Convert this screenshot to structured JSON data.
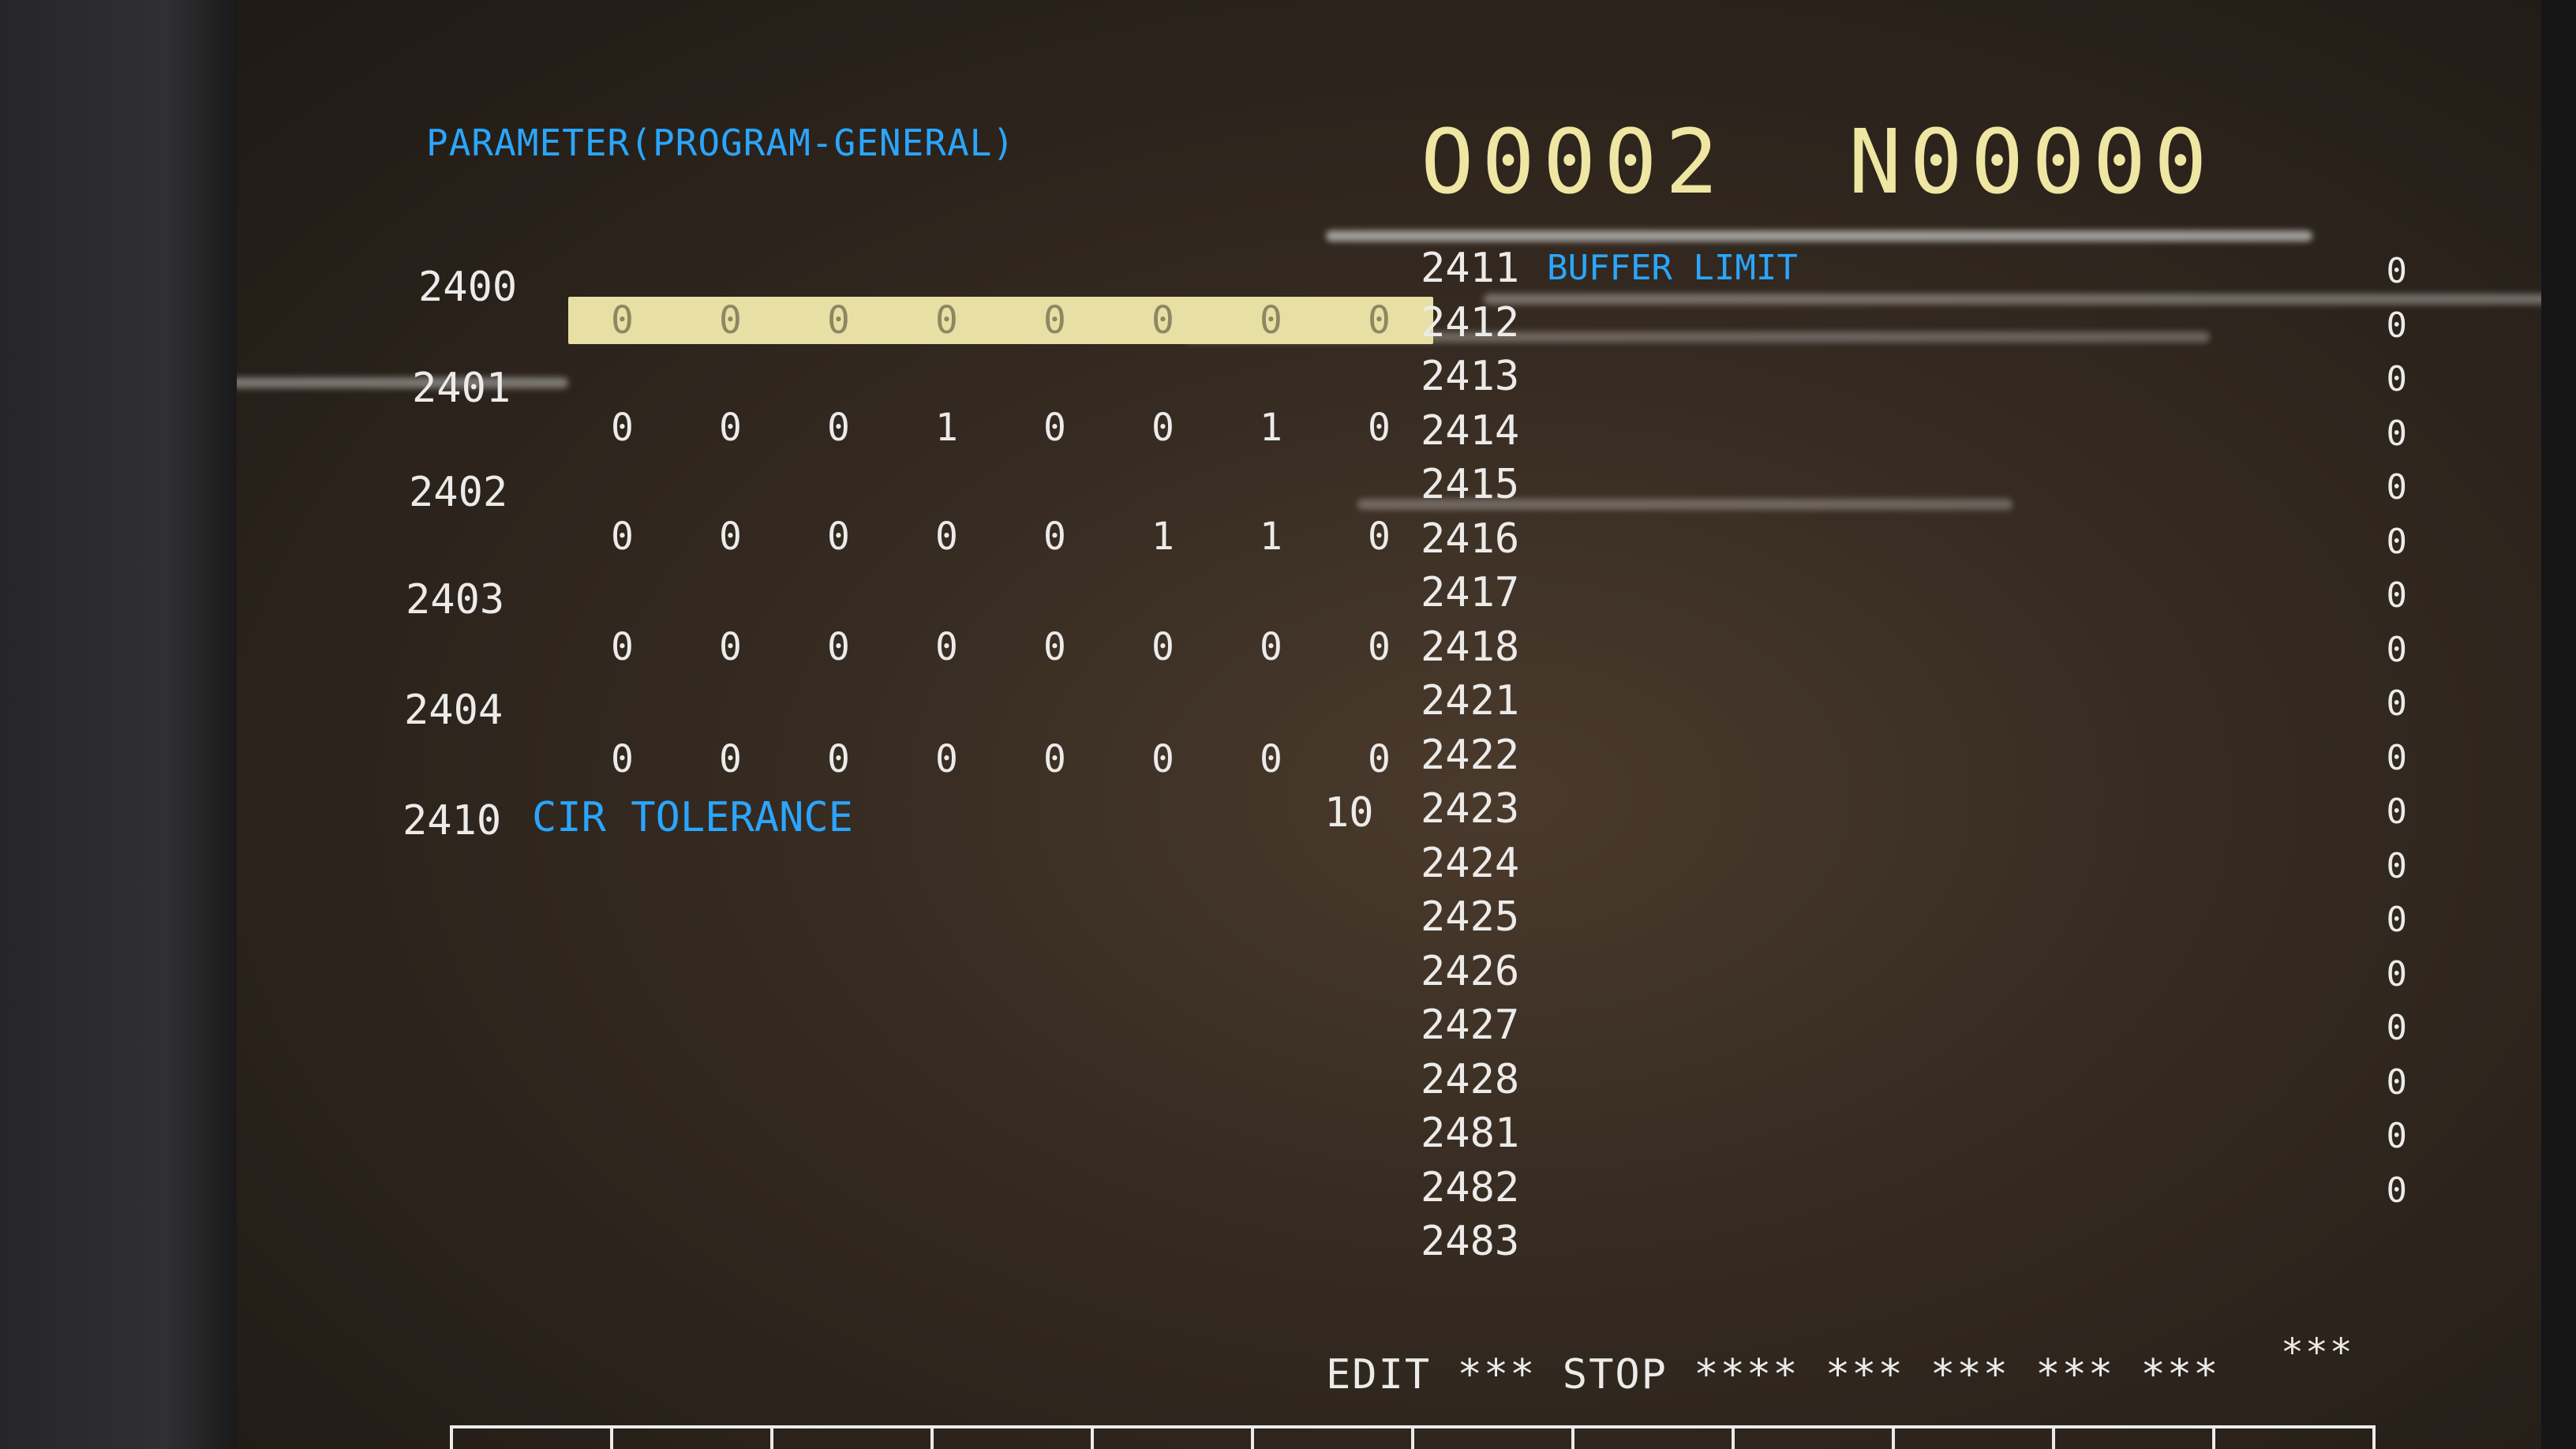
{
  "header": {
    "title": "PARAMETER(PROGRAM-GENERAL)",
    "program_number": "O0002",
    "sequence_number": "N00000"
  },
  "bit_params": [
    {
      "number": "2400",
      "bits": [
        "0",
        "0",
        "0",
        "0",
        "0",
        "0",
        "0",
        "0"
      ],
      "selected": true
    },
    {
      "number": "2401",
      "bits": [
        "0",
        "0",
        "0",
        "1",
        "0",
        "0",
        "1",
        "0"
      ]
    },
    {
      "number": "2402",
      "bits": [
        "0",
        "0",
        "0",
        "0",
        "0",
        "1",
        "1",
        "0"
      ]
    },
    {
      "number": "2403",
      "bits": [
        "0",
        "0",
        "0",
        "0",
        "0",
        "0",
        "0",
        "0"
      ]
    },
    {
      "number": "2404",
      "bits": [
        "0",
        "0",
        "0",
        "0",
        "0",
        "0",
        "0",
        "0"
      ]
    }
  ],
  "cir_tolerance": {
    "number": "2410",
    "name": "CIR TOLERANCE",
    "value": "10"
  },
  "right_params": [
    {
      "number": "2411",
      "name": "BUFFER LIMIT",
      "value": "0"
    },
    {
      "number": "2412",
      "value": "0"
    },
    {
      "number": "2413",
      "value": "0"
    },
    {
      "number": "2414",
      "value": "0"
    },
    {
      "number": "2415",
      "value": "0"
    },
    {
      "number": "2416",
      "value": "0"
    },
    {
      "number": "2417",
      "value": "0"
    },
    {
      "number": "2418",
      "value": "0"
    },
    {
      "number": "2421",
      "value": "0"
    },
    {
      "number": "2422",
      "value": "0"
    },
    {
      "number": "2423",
      "value": "0"
    },
    {
      "number": "2424",
      "value": "0"
    },
    {
      "number": "2425",
      "value": "0"
    },
    {
      "number": "2426",
      "value": "0"
    },
    {
      "number": "2427",
      "value": "0"
    },
    {
      "number": "2428",
      "value": "0"
    },
    {
      "number": "2481",
      "value": "0"
    },
    {
      "number": "2482",
      "value": "0"
    },
    {
      "number": "2483",
      "value": ""
    }
  ],
  "status_bar": {
    "text": "EDIT *** STOP **** *** *** *** ***",
    "right_text": "***"
  },
  "colors": {
    "cyan": "#2aa6ff",
    "white": "#ecebea",
    "yellow": "#eee6a2",
    "cursor": "#e8dfa4"
  }
}
